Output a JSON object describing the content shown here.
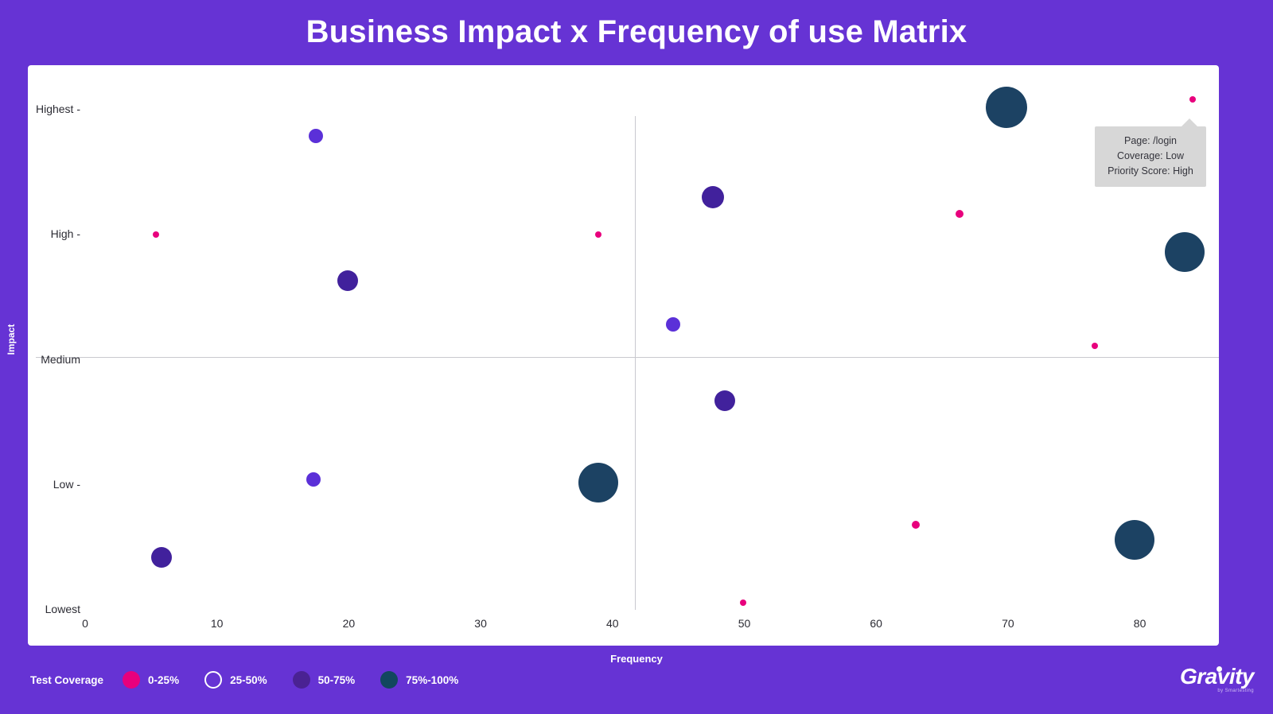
{
  "title": "Business Impact x Frequency of use Matrix",
  "axes": {
    "x_title": "Frequency",
    "y_title": "Impact"
  },
  "tooltip": {
    "page_line": "Page: /login",
    "coverage_line": "Coverage: Low",
    "priority_line": "Priority Score: High"
  },
  "legend": {
    "title": "Test Coverage",
    "items": [
      {
        "label": "0-25%",
        "color": "#e8007d",
        "hollow": false
      },
      {
        "label": "25-50%",
        "color": "#ffffff",
        "hollow": true
      },
      {
        "label": "50-75%",
        "color": "#4a2293",
        "hollow": false
      },
      {
        "label": "75%-100%",
        "color": "#12475e",
        "hollow": false
      }
    ]
  },
  "logo": {
    "word": "Gravity",
    "subtitle": "by Smartesting"
  },
  "colors": {
    "background": "#6633d4",
    "card": "#ffffff",
    "grid": "#c9c9cf",
    "pink": "#e8007d",
    "violet": "#5b30d8",
    "purple": "#41219c",
    "navy": "#1c4263",
    "tooltip_bg": "#d7d7d7"
  },
  "chart_data": {
    "type": "scatter",
    "title": "Business Impact x Frequency of use Matrix",
    "xlabel": "Frequency",
    "ylabel": "Impact",
    "xlim": [
      0,
      86
    ],
    "ylim": [
      0,
      4
    ],
    "grid": true,
    "legend_position": "bottom-left",
    "x_ticks": [
      {
        "label": "0",
        "value": 0
      },
      {
        "label": "10",
        "value": 10
      },
      {
        "label": "20",
        "value": 20
      },
      {
        "label": "30",
        "value": 30
      },
      {
        "label": "40",
        "value": 40
      },
      {
        "label": "50",
        "value": 50
      },
      {
        "label": "60",
        "value": 60
      },
      {
        "label": "70",
        "value": 70
      },
      {
        "label": "80",
        "value": 80
      }
    ],
    "y_ticks": [
      {
        "label": "Highest -",
        "value": 4
      },
      {
        "label": "High -",
        "value": 3
      },
      {
        "label": "Medium",
        "value": 2
      },
      {
        "label": "Low -",
        "value": 1
      },
      {
        "label": "Lowest",
        "value": 0
      }
    ],
    "quadrant_lines": {
      "x": 40,
      "y": 2
    },
    "series": [
      {
        "name": "0-25%",
        "color": "#e8007d",
        "points": [
          {
            "x": 5.4,
            "y": 3.0,
            "r": 4
          },
          {
            "x": 38.9,
            "y": 3.0,
            "r": 4
          },
          {
            "x": 84.0,
            "y": 4.08,
            "r": 4
          },
          {
            "x": 66.3,
            "y": 3.17,
            "r": 5
          },
          {
            "x": 76.6,
            "y": 2.11,
            "r": 4
          },
          {
            "x": 63.0,
            "y": 0.68,
            "r": 5
          },
          {
            "x": 49.9,
            "y": 0.06,
            "r": 4
          }
        ]
      },
      {
        "name": "50-75%",
        "color": "#5b30d8",
        "points": [
          {
            "x": 17.5,
            "y": 3.79,
            "r": 9
          },
          {
            "x": 17.3,
            "y": 1.04,
            "r": 9
          },
          {
            "x": 44.6,
            "y": 2.28,
            "r": 9
          }
        ]
      },
      {
        "name": "50-75%-dark",
        "color": "#41219c",
        "points": [
          {
            "x": 19.9,
            "y": 2.63,
            "r": 13
          },
          {
            "x": 5.8,
            "y": 0.42,
            "r": 13
          },
          {
            "x": 47.6,
            "y": 3.3,
            "r": 14
          },
          {
            "x": 48.5,
            "y": 1.67,
            "r": 13
          }
        ]
      },
      {
        "name": "75%-100%",
        "color": "#1c4263",
        "points": [
          {
            "x": 69.9,
            "y": 4.02,
            "r": 26
          },
          {
            "x": 83.4,
            "y": 2.86,
            "r": 25
          },
          {
            "x": 38.9,
            "y": 1.02,
            "r": 25
          },
          {
            "x": 79.6,
            "y": 0.56,
            "r": 25
          }
        ]
      }
    ]
  }
}
